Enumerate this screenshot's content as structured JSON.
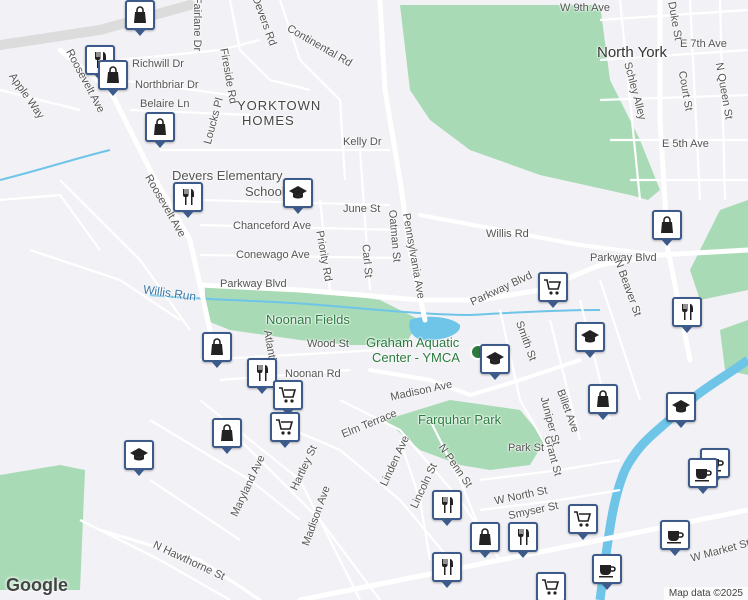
{
  "labels": {
    "areas": [
      {
        "text": "YORKTOWN",
        "name": "yorktown-label"
      },
      {
        "text": "HOMES",
        "name": "homes-label"
      },
      {
        "text": "North York",
        "name": "north-york-label"
      }
    ],
    "streets": [
      {
        "text": "Roosevelt Ave",
        "name": "roosevelt-ave-label-1"
      },
      {
        "text": "Roosevelt Ave",
        "name": "roosevelt-ave-label-2"
      },
      {
        "text": "Apple Way",
        "name": "apple-way-label"
      },
      {
        "text": "Fairlane Dr",
        "name": "fairlane-dr-label"
      },
      {
        "text": "Richwill Dr",
        "name": "richwill-dr-label"
      },
      {
        "text": "Northbriar Dr",
        "name": "northbriar-dr-label"
      },
      {
        "text": "Belaire Ln",
        "name": "belaire-ln-label"
      },
      {
        "text": "Loucks Pl",
        "name": "loucks-pl-label"
      },
      {
        "text": "Fireside Rd",
        "name": "fireside-rd-label"
      },
      {
        "text": "Devers Rd",
        "name": "devers-rd-label"
      },
      {
        "text": "Continental Rd",
        "name": "continental-rd-label"
      },
      {
        "text": "Kelly Dr",
        "name": "kelly-dr-label"
      },
      {
        "text": "June St",
        "name": "june-st-label"
      },
      {
        "text": "Chanceford Ave",
        "name": "chanceford-ave-label"
      },
      {
        "text": "Conewago Ave",
        "name": "conewago-ave-label"
      },
      {
        "text": "Priority Rd",
        "name": "priority-rd-label"
      },
      {
        "text": "Carl St",
        "name": "carl-st-label"
      },
      {
        "text": "Oatman St",
        "name": "oatman-st-label"
      },
      {
        "text": "Pennsylvania Ave",
        "name": "pennsylvania-ave-label"
      },
      {
        "text": "Parkway Blvd",
        "name": "parkway-blvd-label-1"
      },
      {
        "text": "Parkway Blvd",
        "name": "parkway-blvd-label-2"
      },
      {
        "text": "Parkway Blvd",
        "name": "parkway-blvd-label-3"
      },
      {
        "text": "Willis Rd",
        "name": "willis-rd-label"
      },
      {
        "text": "Wood St",
        "name": "wood-st-label"
      },
      {
        "text": "Noonan Rd",
        "name": "noonan-rd-label"
      },
      {
        "text": "Madison Ave",
        "name": "madison-ave-label-1"
      },
      {
        "text": "Madison Ave",
        "name": "madison-ave-label-2"
      },
      {
        "text": "Elm Terrace",
        "name": "elm-terrace-label"
      },
      {
        "text": "Hartley St",
        "name": "hartley-st-label"
      },
      {
        "text": "Maryland Ave",
        "name": "maryland-ave-label"
      },
      {
        "text": "Linden Ave",
        "name": "linden-ave-label"
      },
      {
        "text": "Lincoln St",
        "name": "lincoln-st-label"
      },
      {
        "text": "N Penn St",
        "name": "n-penn-st-label"
      },
      {
        "text": "Park St",
        "name": "park-st-label"
      },
      {
        "text": "Grant St",
        "name": "grant-st-label"
      },
      {
        "text": "Juniper St",
        "name": "juniper-st-label"
      },
      {
        "text": "Billet Ave",
        "name": "billet-ave-label"
      },
      {
        "text": "Smith St",
        "name": "smith-st-label"
      },
      {
        "text": "W North St",
        "name": "w-north-st-label"
      },
      {
        "text": "Smyser St",
        "name": "smyser-st-label"
      },
      {
        "text": "N Hawthorne St",
        "name": "n-hawthorne-st-label"
      },
      {
        "text": "W Market St",
        "name": "w-market-st-label"
      },
      {
        "text": "W 9th Ave",
        "name": "w-9th-ave-label"
      },
      {
        "text": "E 7th Ave",
        "name": "e-7th-ave-label"
      },
      {
        "text": "E 5th Ave",
        "name": "e-5th-ave-label"
      },
      {
        "text": "Duke St",
        "name": "duke-st-label"
      },
      {
        "text": "Court St",
        "name": "court-st-label"
      },
      {
        "text": "N Queen St",
        "name": "n-queen-st-label"
      },
      {
        "text": "Schley Alley",
        "name": "schley-alley-label"
      },
      {
        "text": "N Beaver St",
        "name": "n-beaver-st-label"
      },
      {
        "text": "Willis Run",
        "name": "willis-run-label"
      },
      {
        "text": "Atlantic",
        "name": "atlantic-label"
      }
    ],
    "parks": [
      {
        "text": "Noonan Fields",
        "name": "noonan-fields-label"
      },
      {
        "text": "Farquhar Park",
        "name": "farquhar-park-label"
      }
    ],
    "pois": [
      {
        "text": "Devers Elementary",
        "name": "devers-elementary-label"
      },
      {
        "text": "School",
        "name": "school-label"
      },
      {
        "text": "Graham Aquatic",
        "name": "graham-aquatic-label"
      },
      {
        "text": "Center - YMCA",
        "name": "center-ymca-label"
      }
    ]
  },
  "pins": [
    {
      "type": "shopping",
      "icon": "shopping-bag-icon"
    },
    {
      "type": "restaurant",
      "icon": "fork-knife-icon"
    },
    {
      "type": "shopping",
      "icon": "shopping-bag-icon"
    },
    {
      "type": "shopping",
      "icon": "shopping-bag-icon"
    },
    {
      "type": "restaurant",
      "icon": "fork-knife-icon"
    },
    {
      "type": "school",
      "icon": "graduation-cap-icon"
    },
    {
      "type": "grocery",
      "icon": "shopping-cart-icon"
    },
    {
      "type": "shopping",
      "icon": "shopping-bag-icon"
    },
    {
      "type": "school",
      "icon": "graduation-cap-icon"
    },
    {
      "type": "restaurant",
      "icon": "fork-knife-icon"
    },
    {
      "type": "shopping",
      "icon": "shopping-bag-icon"
    },
    {
      "type": "restaurant",
      "icon": "fork-knife-icon"
    },
    {
      "type": "grocery",
      "icon": "shopping-cart-icon"
    },
    {
      "type": "grocery",
      "icon": "shopping-cart-icon"
    },
    {
      "type": "shopping",
      "icon": "shopping-bag-icon"
    },
    {
      "type": "school",
      "icon": "graduation-cap-icon"
    },
    {
      "type": "school",
      "icon": "graduation-cap-icon"
    },
    {
      "type": "shopping",
      "icon": "shopping-bag-icon"
    },
    {
      "type": "school",
      "icon": "graduation-cap-icon"
    },
    {
      "type": "cafe",
      "icon": "coffee-cup-icon"
    },
    {
      "type": "cafe",
      "icon": "coffee-cup-icon"
    },
    {
      "type": "restaurant",
      "icon": "fork-knife-icon"
    },
    {
      "type": "grocery",
      "icon": "shopping-cart-icon"
    },
    {
      "type": "shopping",
      "icon": "shopping-bag-icon"
    },
    {
      "type": "restaurant",
      "icon": "fork-knife-icon"
    },
    {
      "type": "restaurant",
      "icon": "fork-knife-icon"
    },
    {
      "type": "grocery",
      "icon": "shopping-cart-icon"
    },
    {
      "type": "cafe",
      "icon": "coffee-cup-icon"
    },
    {
      "type": "cafe",
      "icon": "coffee-cup-icon"
    }
  ],
  "attribution": {
    "logo": "Google",
    "data": "Map data ©2025"
  },
  "colors": {
    "background": "#f2f1f5",
    "park": "#a8dab5",
    "water": "#6ec5e8",
    "pin_border": "#3c5a8a",
    "major_road": "#ffffff"
  }
}
